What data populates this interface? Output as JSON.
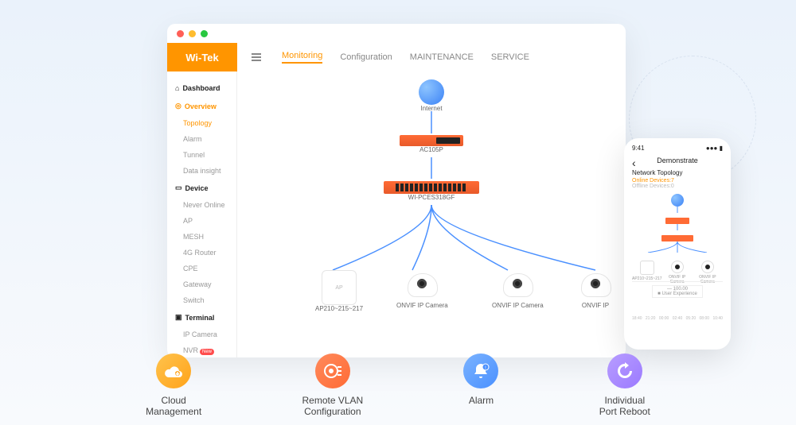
{
  "logo": "Wi-Tek",
  "tabs": {
    "monitoring": "Monitoring",
    "configuration": "Configuration",
    "maintenance": "MAINTENANCE",
    "service": "SERVICE"
  },
  "sidebar": {
    "dashboard": "Dashboard",
    "overview": "Overview",
    "overview_items": {
      "topology": "Topology",
      "alarm": "Alarm",
      "tunnel": "Tunnel",
      "data_insight": "Data insight"
    },
    "device": "Device",
    "device_items": {
      "never_online": "Never Online",
      "ap": "AP",
      "mesh": "MESH",
      "router4g": "4G Router",
      "cpe": "CPE",
      "gateway": "Gateway",
      "switch": "Switch"
    },
    "terminal": "Terminal",
    "terminal_items": {
      "ip_camera": "IP Camera",
      "nvr": "NVR"
    },
    "new_badge": "New"
  },
  "topology": {
    "internet": "Internet",
    "router": "AC105P",
    "switch": "WI-PCES318GF",
    "ap_label": "AP",
    "ap_name": "AP210~215~217",
    "cam1": "ONVIF IP Camera",
    "cam2": "ONVIF IP Camera",
    "cam3": "ONVIF IP"
  },
  "phone": {
    "time": "9:41",
    "title": "Demonstrate",
    "section": "Network Topology",
    "online": "Online Devices:7",
    "offline": "Offline Devices:0",
    "mini": {
      "ap": "AP210~215~217",
      "cam1": "ONVIF IP Camera",
      "cam2": "ONVIF IP Camera"
    },
    "legend1": "— 100.00",
    "legend2": "■ User Experience",
    "axis": [
      "18:40",
      "21:20",
      "00:00",
      "02:40",
      "05:20",
      "08:00",
      "10:40"
    ]
  },
  "features": {
    "cloud": "Cloud\nManagement",
    "vlan": "Remote VLAN\nConfiguration",
    "alarm": "Alarm",
    "reboot": "Individual\nPort Reboot"
  }
}
